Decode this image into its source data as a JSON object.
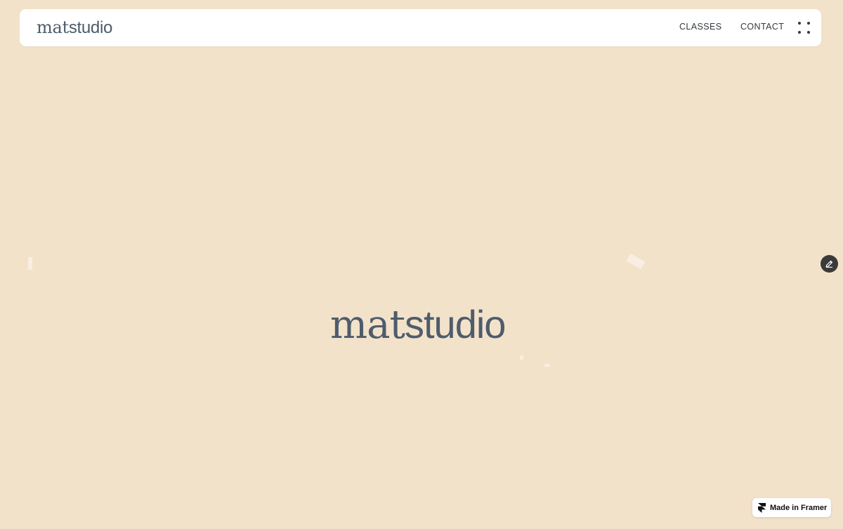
{
  "brand": {
    "mat": "mat",
    "studio": "studio"
  },
  "nav": {
    "items": [
      {
        "label": "CLASSES"
      },
      {
        "label": "CONTACT"
      }
    ],
    "menu_icon": "dots-grid-icon"
  },
  "hero": {
    "mat": "mat",
    "studio": "studio"
  },
  "edit_button": {
    "icon": "pencil-icon"
  },
  "badge": {
    "label": "Made in Framer",
    "icon": "framer-logo-icon"
  },
  "colors": {
    "background": "#f3e2ca",
    "navbar": "#ffffff",
    "logo_text": "#4e5c6c",
    "nav_text": "#333a40",
    "edit_button": "#3a3a3a"
  }
}
